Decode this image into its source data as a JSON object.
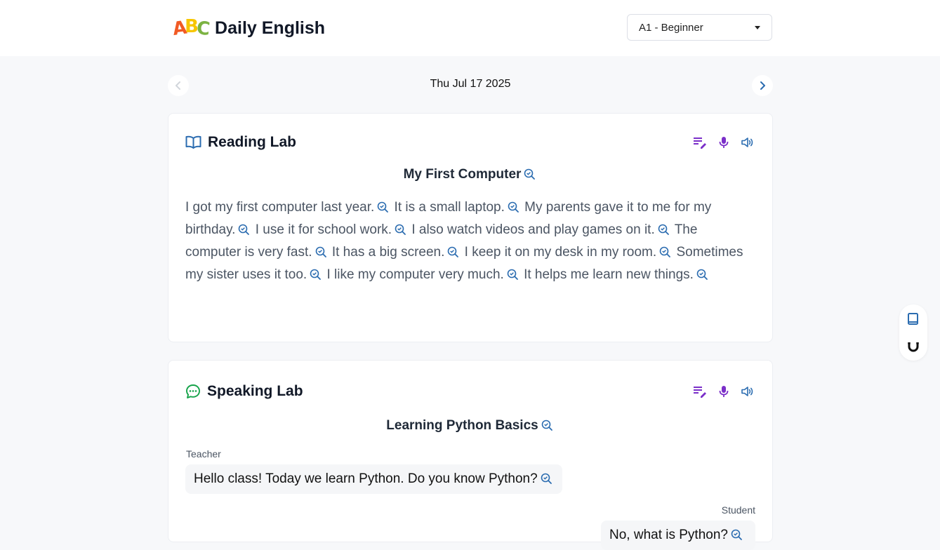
{
  "app": {
    "logo_text": "ABC",
    "title": "Daily English"
  },
  "level_select": {
    "value": "A1 - Beginner"
  },
  "date_nav": {
    "date": "Thu Jul 17 2025"
  },
  "reading_lab": {
    "title": "Reading Lab",
    "lesson_title": "My First Computer",
    "sentences": [
      "I got my first computer last year.",
      "It is a small laptop.",
      "My parents gave it to me for my birthday.",
      "I use it for school work.",
      "I also watch videos and play games on it.",
      "The computer is very fast.",
      "It has a big screen.",
      "I keep it on my desk in my room.",
      "Sometimes my sister uses it too.",
      "I like my computer very much.",
      "It helps me learn new things."
    ]
  },
  "speaking_lab": {
    "title": "Speaking Lab",
    "lesson_title": "Learning Python Basics",
    "dialogue": [
      {
        "role": "Teacher",
        "text": "Hello class! Today we learn Python. Do you know Python?"
      },
      {
        "role": "Student",
        "text": "No, what is Python?"
      }
    ]
  },
  "icons": {
    "reading": "book-open-icon",
    "speaking": "chat-bubble-icon",
    "tools": [
      "edit-list-icon",
      "microphone-icon",
      "speaker-icon"
    ],
    "sentence": "search-check-icon",
    "side_panel": [
      "notebook-icon",
      "magnet-icon"
    ]
  },
  "colors": {
    "brand_blue": "#2b6cb0",
    "tool_purple": "#7b2fc9",
    "speaking_green": "#16a34a"
  }
}
